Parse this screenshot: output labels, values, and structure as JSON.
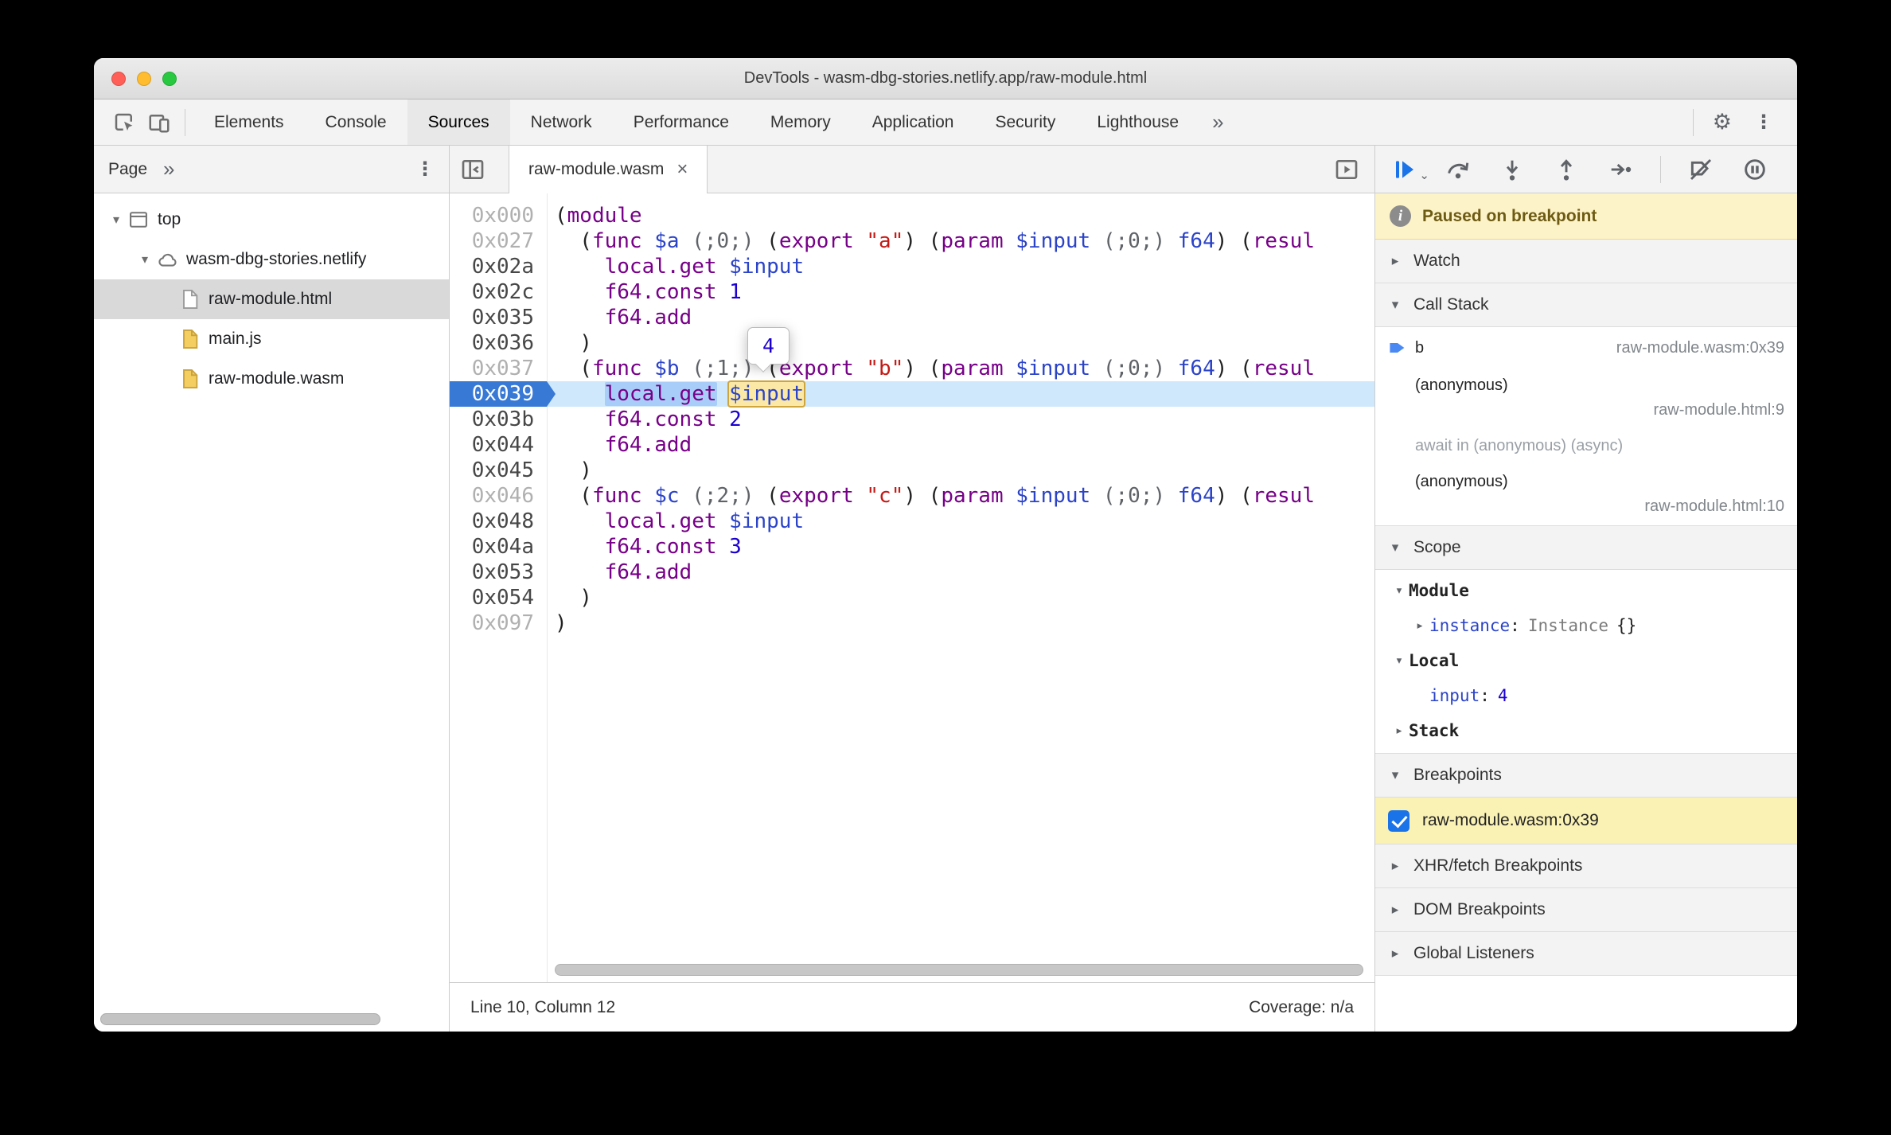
{
  "colors": {
    "accent_blue": "#1a73e8",
    "current_line_bg": "#cfe8fc",
    "current_line_marker": "#3879d6",
    "paused_banner_bg": "#fdf3c9",
    "breakpoint_row_bg": "#faf1b5",
    "eval_highlight_bg": "#fbe8a6",
    "eval_highlight_border": "#cfa53d",
    "selection_bg": "#a8cdf8"
  },
  "window": {
    "title": "DevTools - wasm-dbg-stories.netlify.app/raw-module.html"
  },
  "toolbar": {
    "icons": [
      "inspect-icon",
      "device-toolbar-icon",
      "settings-gear-icon",
      "customize-menu-icon"
    ],
    "tabs": [
      {
        "label": "Elements"
      },
      {
        "label": "Console"
      },
      {
        "label": "Sources",
        "selected": true
      },
      {
        "label": "Network"
      },
      {
        "label": "Performance"
      },
      {
        "label": "Memory"
      },
      {
        "label": "Application"
      },
      {
        "label": "Security"
      },
      {
        "label": "Lighthouse"
      }
    ],
    "more_tabs": "»",
    "gear_glyph": "⚙",
    "kebab_glyph": "⋮"
  },
  "sidebar": {
    "tab": "Page",
    "more": "»",
    "kebab_glyph": "⋮",
    "tree": [
      {
        "label": "top",
        "level": 0,
        "icon": "frame",
        "expanded": true
      },
      {
        "label": "wasm-dbg-stories.netlify",
        "level": 1,
        "icon": "cloud",
        "expanded": true
      },
      {
        "label": "raw-module.html",
        "level": 2,
        "icon": "file-html",
        "selected": true
      },
      {
        "label": "main.js",
        "level": 2,
        "icon": "file-js"
      },
      {
        "label": "raw-module.wasm",
        "level": 2,
        "icon": "file-wasm"
      }
    ]
  },
  "editor": {
    "tab": {
      "label": "raw-module.wasm",
      "close": "×"
    },
    "inline_value": "4",
    "status": {
      "left": "Line 10, Column 12",
      "right": "Coverage: n/a"
    },
    "lines": [
      {
        "addr": "0x000",
        "dim": true,
        "tokens": [
          [
            "pl",
            "("
          ],
          [
            "kw",
            "module"
          ]
        ]
      },
      {
        "addr": "0x027",
        "dim": true,
        "tokens": [
          [
            "pl",
            "  ("
          ],
          [
            "kw",
            "func"
          ],
          [
            "pl",
            " "
          ],
          [
            "vr",
            "$a"
          ],
          [
            "pl",
            " "
          ],
          [
            "cm",
            "(;0;)"
          ],
          [
            "pl",
            " ("
          ],
          [
            "kw",
            "export"
          ],
          [
            "pl",
            " "
          ],
          [
            "st",
            "\"a\""
          ],
          [
            "pl",
            ") ("
          ],
          [
            "kw",
            "param"
          ],
          [
            "pl",
            " "
          ],
          [
            "vr",
            "$input"
          ],
          [
            "pl",
            " "
          ],
          [
            "cm",
            "(;0;)"
          ],
          [
            "pl",
            " "
          ],
          [
            "vr",
            "f64"
          ],
          [
            "pl",
            ") ("
          ],
          [
            "kw",
            "resul"
          ]
        ]
      },
      {
        "addr": "0x02a",
        "tokens": [
          [
            "pl",
            "    "
          ],
          [
            "kw",
            "local.get"
          ],
          [
            "pl",
            " "
          ],
          [
            "vr",
            "$input"
          ]
        ]
      },
      {
        "addr": "0x02c",
        "tokens": [
          [
            "pl",
            "    "
          ],
          [
            "kw",
            "f64.const"
          ],
          [
            "pl",
            " "
          ],
          [
            "nm",
            "1"
          ]
        ]
      },
      {
        "addr": "0x035",
        "tokens": [
          [
            "pl",
            "    "
          ],
          [
            "kw",
            "f64.add"
          ]
        ]
      },
      {
        "addr": "0x036",
        "tokens": [
          [
            "pl",
            "  )"
          ]
        ]
      },
      {
        "addr": "0x037",
        "dim": true,
        "tokens": [
          [
            "pl",
            "  ("
          ],
          [
            "kw",
            "func"
          ],
          [
            "pl",
            " "
          ],
          [
            "vr",
            "$b"
          ],
          [
            "pl",
            " "
          ],
          [
            "cm",
            "(;1;)"
          ],
          [
            "pl",
            " ("
          ],
          [
            "kw",
            "export"
          ],
          [
            "pl",
            " "
          ],
          [
            "st",
            "\"b\""
          ],
          [
            "pl",
            ") ("
          ],
          [
            "kw",
            "param"
          ],
          [
            "pl",
            " "
          ],
          [
            "vr",
            "$input"
          ],
          [
            "pl",
            " "
          ],
          [
            "cm",
            "(;0;)"
          ],
          [
            "pl",
            " "
          ],
          [
            "vr",
            "f64"
          ],
          [
            "pl",
            ") ("
          ],
          [
            "kw",
            "resul"
          ]
        ]
      },
      {
        "addr": "0x039",
        "current": true,
        "tokens": [
          [
            "pl",
            "    "
          ],
          [
            "kw-sel",
            "local.get"
          ],
          [
            "pl",
            " "
          ],
          [
            "vr-eval",
            "$input"
          ]
        ]
      },
      {
        "addr": "0x03b",
        "tokens": [
          [
            "pl",
            "    "
          ],
          [
            "kw",
            "f64.const"
          ],
          [
            "pl",
            " "
          ],
          [
            "nm",
            "2"
          ]
        ]
      },
      {
        "addr": "0x044",
        "tokens": [
          [
            "pl",
            "    "
          ],
          [
            "kw",
            "f64.add"
          ]
        ]
      },
      {
        "addr": "0x045",
        "tokens": [
          [
            "pl",
            "  )"
          ]
        ]
      },
      {
        "addr": "0x046",
        "dim": true,
        "tokens": [
          [
            "pl",
            "  ("
          ],
          [
            "kw",
            "func"
          ],
          [
            "pl",
            " "
          ],
          [
            "vr",
            "$c"
          ],
          [
            "pl",
            " "
          ],
          [
            "cm",
            "(;2;)"
          ],
          [
            "pl",
            " ("
          ],
          [
            "kw",
            "export"
          ],
          [
            "pl",
            " "
          ],
          [
            "st",
            "\"c\""
          ],
          [
            "pl",
            ") ("
          ],
          [
            "kw",
            "param"
          ],
          [
            "pl",
            " "
          ],
          [
            "vr",
            "$input"
          ],
          [
            "pl",
            " "
          ],
          [
            "cm",
            "(;0;)"
          ],
          [
            "pl",
            " "
          ],
          [
            "vr",
            "f64"
          ],
          [
            "pl",
            ") ("
          ],
          [
            "kw",
            "resul"
          ]
        ]
      },
      {
        "addr": "0x048",
        "tokens": [
          [
            "pl",
            "    "
          ],
          [
            "kw",
            "local.get"
          ],
          [
            "pl",
            " "
          ],
          [
            "vr",
            "$input"
          ]
        ]
      },
      {
        "addr": "0x04a",
        "tokens": [
          [
            "pl",
            "    "
          ],
          [
            "kw",
            "f64.const"
          ],
          [
            "pl",
            " "
          ],
          [
            "nm",
            "3"
          ]
        ]
      },
      {
        "addr": "0x053",
        "tokens": [
          [
            "pl",
            "    "
          ],
          [
            "kw",
            "f64.add"
          ]
        ]
      },
      {
        "addr": "0x054",
        "tokens": [
          [
            "pl",
            "  )"
          ]
        ]
      },
      {
        "addr": "0x097",
        "dim": true,
        "tokens": [
          [
            "pl",
            ")"
          ]
        ]
      }
    ]
  },
  "debugger": {
    "controls": [
      "resume",
      "step-over",
      "step-into",
      "step-out",
      "step",
      "deactivate-breakpoints",
      "pause-on-exceptions"
    ],
    "paused_message": "Paused on breakpoint",
    "watch": {
      "title": "Watch",
      "expanded": false
    },
    "call_stack": {
      "title": "Call Stack",
      "frames": [
        {
          "type": "frame",
          "name": "b",
          "location": "raw-module.wasm:0x39",
          "current": true
        },
        {
          "type": "frame",
          "name": "(anonymous)",
          "location": "raw-module.html:9"
        },
        {
          "type": "async",
          "label": "await in (anonymous) (async)"
        },
        {
          "type": "frame",
          "name": "(anonymous)",
          "location": "raw-module.html:10"
        }
      ]
    },
    "scope": {
      "title": "Scope",
      "nodes": [
        {
          "kind": "group",
          "name": "Module",
          "expanded": true
        },
        {
          "kind": "prop",
          "name": "instance",
          "value_class": "Instance",
          "value": "{}",
          "value_type": "object",
          "expandable": true
        },
        {
          "kind": "group",
          "name": "Local",
          "expanded": true
        },
        {
          "kind": "prop",
          "name": "input",
          "value": "4",
          "value_type": "number"
        },
        {
          "kind": "group",
          "name": "Stack",
          "expanded": false
        }
      ]
    },
    "breakpoints": {
      "title": "Breakpoints",
      "items": [
        {
          "label": "raw-module.wasm:0x39",
          "checked": true
        }
      ]
    },
    "other_sections": [
      {
        "title": "XHR/fetch Breakpoints"
      },
      {
        "title": "DOM Breakpoints"
      },
      {
        "title": "Global Listeners"
      }
    ]
  }
}
